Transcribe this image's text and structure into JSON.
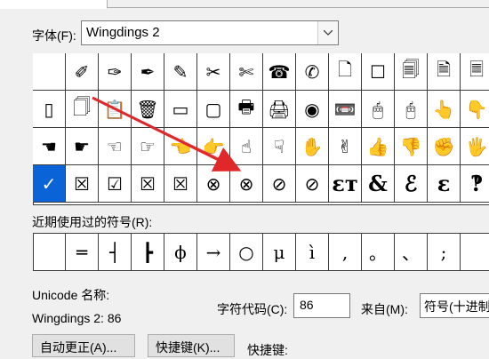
{
  "dialog": {
    "font_label": "字体(F):",
    "font_value": "Wingdings 2",
    "recent_label": "近期使用过的符号(R):",
    "unicode_name_label": "Unicode 名称:",
    "unicode_name_value": "Wingdings 2: 86",
    "char_code_label": "字符代码(C):",
    "char_code_value": "86",
    "from_label": "来自(M):",
    "from_value": "符号(十进制",
    "autocorrect_button": "自动更正(A)...",
    "shortcut_button": "快捷键(K)...",
    "shortcut_label": "快捷键:"
  },
  "symbol_grid": {
    "selected_index": 42,
    "rows": [
      [
        " ",
        "✐",
        "✑",
        "✒",
        "✎",
        "✂",
        "✄",
        "☎",
        "✆",
        "🗋",
        "☐",
        "🗐",
        "🗎",
        "🗏"
      ],
      [
        "▯",
        "🗍",
        "📋",
        "🗑",
        "▭",
        "▢",
        "🖶",
        "🖨",
        "◉",
        "📼",
        "🖱",
        "🖰",
        "👆",
        "👇"
      ],
      [
        "☚",
        "☛",
        "☜",
        "☞",
        "👈",
        "👉",
        "☝",
        "☟",
        "✋",
        "✌",
        "👍",
        "👎",
        "✊",
        "🖐"
      ],
      [
        "✓",
        "☒",
        "☑",
        "☒",
        "☒",
        "⊗",
        "⊗",
        "⊘",
        "⊘",
        "ɛт",
        "&",
        "ℰ",
        "ɛ",
        "‽"
      ]
    ]
  },
  "recent_symbols": [
    " ",
    "═",
    "┤",
    "┣",
    "ϕ",
    "→",
    "○",
    "μ",
    "ì",
    ",",
    "。",
    "、",
    ";",
    ""
  ],
  "colors": {
    "selection": "#0a64d8",
    "annotation_arrow": "#e0282b"
  }
}
